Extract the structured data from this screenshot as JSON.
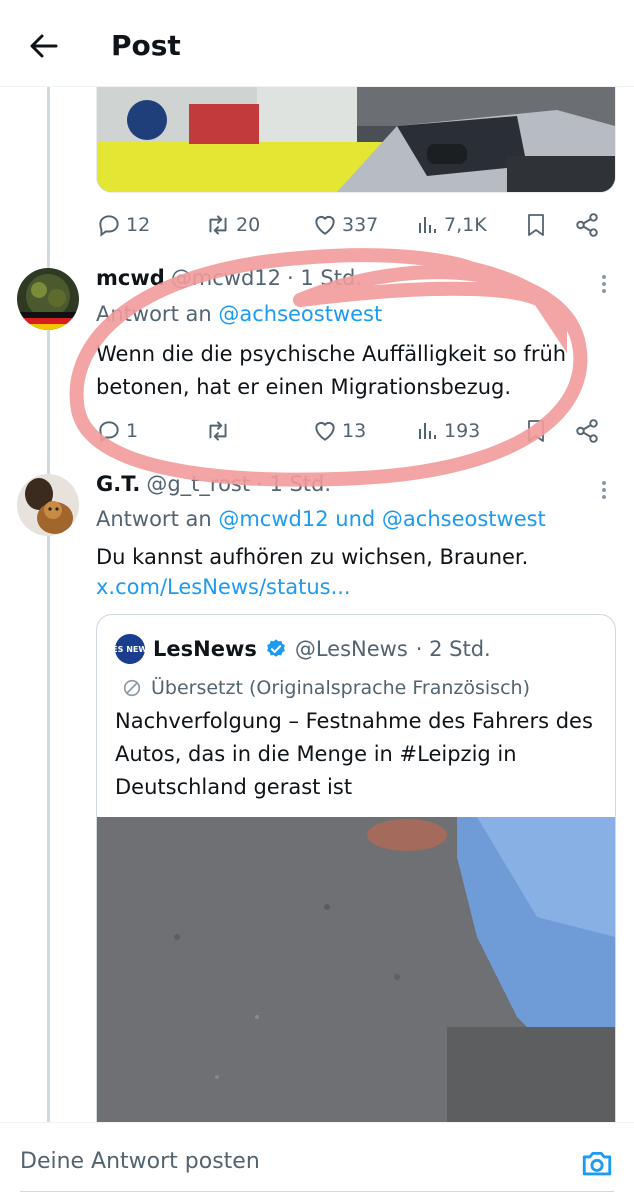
{
  "header": {
    "title": "Post"
  },
  "top_post_actions": {
    "replies": "12",
    "reposts": "20",
    "likes": "337",
    "views": "7,1K"
  },
  "posts": [
    {
      "name": "mcwd",
      "handle": "@mcwd12",
      "time": "· 1 Std.",
      "reply_prefix": "Antwort an",
      "reply_mentions": "@achseostwest",
      "text": "Wenn die die psychische Auffälligkeit so früh betonen, hat er einen Migrationsbezug.",
      "actions": {
        "replies": "1",
        "reposts": "",
        "likes": "13",
        "views": "193"
      }
    },
    {
      "name": "G.T.",
      "handle": "@g_t_rost",
      "time": "· 1 Std.",
      "reply_prefix": "Antwort an",
      "reply_mention_1": "@mcwd12",
      "reply_joiner": "und",
      "reply_mention_2": "@achseostwest",
      "text": "Du kannst aufhören zu wichsen, Brauner.",
      "link": "x.com/LesNews/status..."
    }
  ],
  "quote": {
    "logo_text": "LES NEWS",
    "name": "LesNews",
    "handle": "@LesNews",
    "time": "· 2 Std.",
    "translated": "Übersetzt (Originalsprache Französisch)",
    "text": "Nachverfolgung – Festnahme des Fahrers des Autos, das in die Menge in #Leipzig in Deutschland gerast ist"
  },
  "composer": {
    "placeholder": "Deine Antwort posten"
  },
  "colors": {
    "accent": "#1d9bf0",
    "muted": "#536471",
    "verified": "#1d9bf0",
    "scribble": "#f29a9a"
  },
  "icons": [
    "back-arrow-icon",
    "reply-icon",
    "repost-icon",
    "like-icon",
    "views-icon",
    "bookmark-icon",
    "share-icon",
    "more-icon",
    "verified-badge-icon",
    "translate-icon",
    "camera-icon"
  ]
}
